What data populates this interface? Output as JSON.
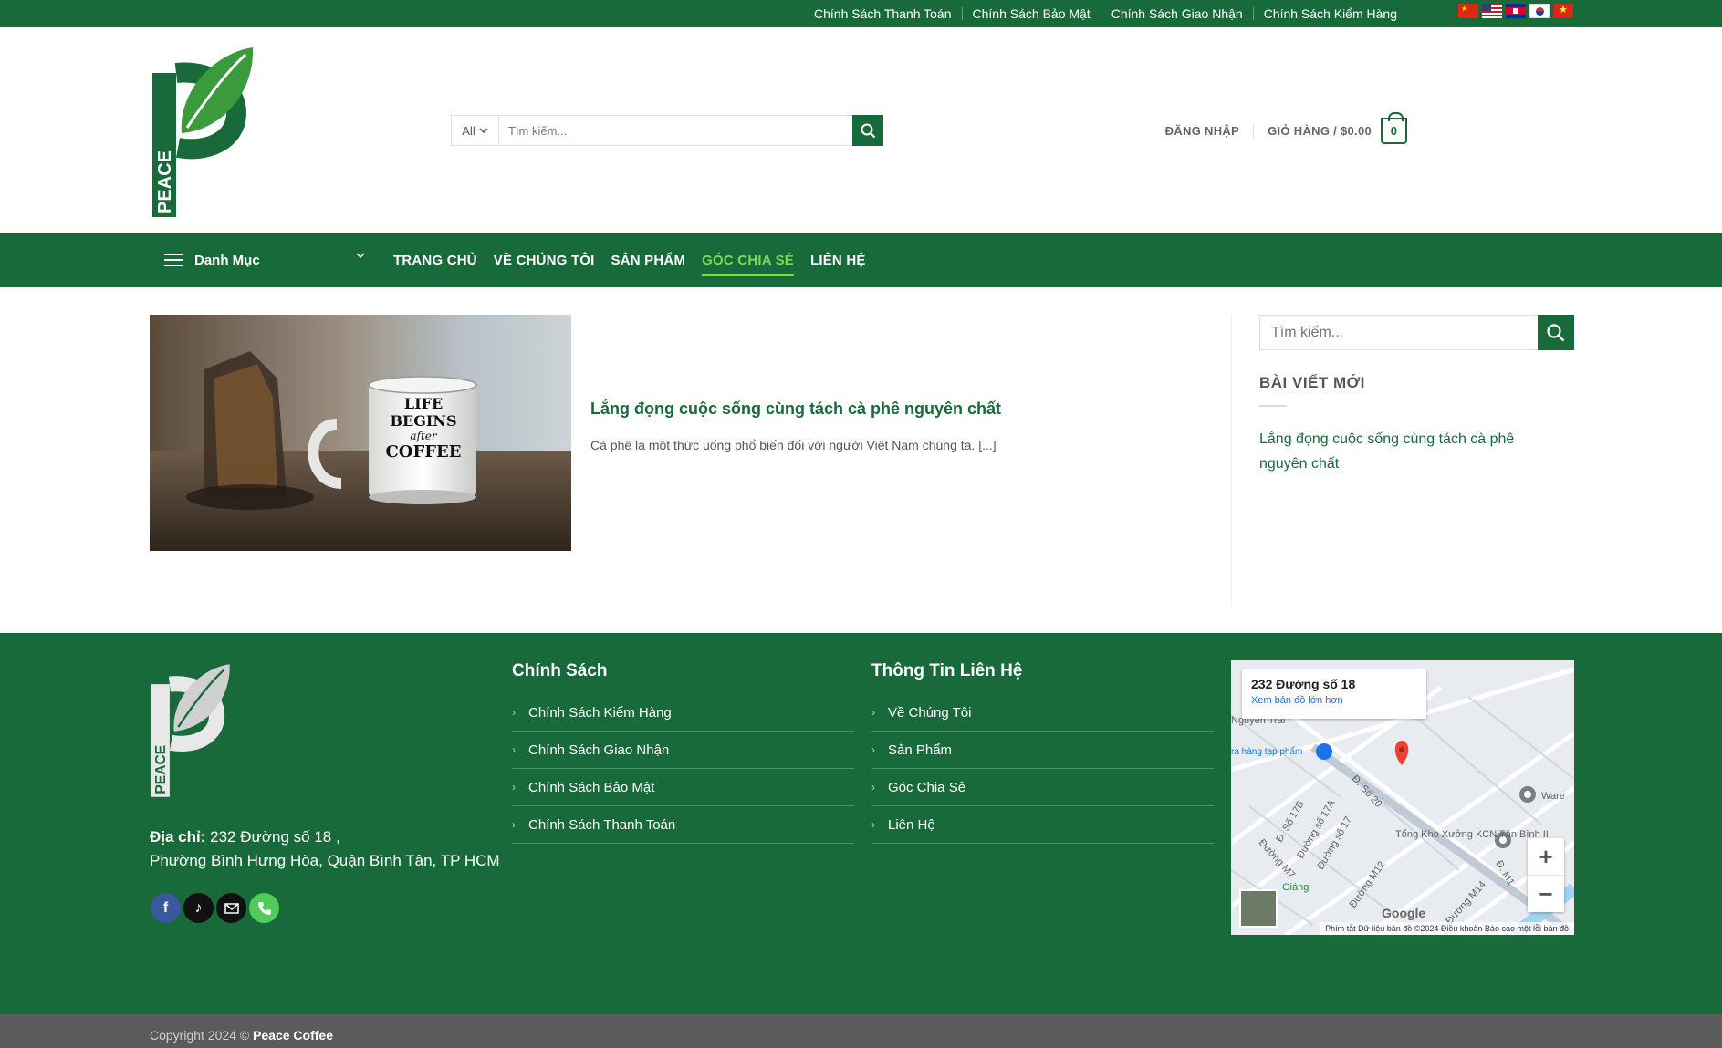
{
  "topbar": {
    "links": [
      "Chính Sách Thanh Toán",
      "Chính Sách Bảo Mật",
      "Chính Sách Giao Nhận",
      "Chính Sách Kiểm Hàng"
    ],
    "flags": [
      "china-flag-icon",
      "usa-flag-icon",
      "cambodia-flag-icon",
      "korea-flag-icon",
      "vietnam-flag-icon"
    ]
  },
  "header": {
    "logo_text": "PEACE",
    "search_category": "All",
    "search_placeholder": "Tìm kiếm...",
    "login": "ĐĂNG NHẬP",
    "cart_label": "GIỎ HÀNG / $0.00",
    "cart_count": "0"
  },
  "nav": {
    "menu_label": "Danh Mục",
    "items": [
      "TRANG CHỦ",
      "VỀ CHÚNG TÔI",
      "SẢN PHẨM",
      "GÓC CHIA SẺ",
      "LIÊN HỆ"
    ],
    "active_index": 3
  },
  "post": {
    "mug_text": [
      "LIFE",
      "BEGINS",
      "after",
      "COFFEE"
    ],
    "title": "Lắng đọng cuộc sống cùng tách cà phê nguyên chất",
    "excerpt": "Cà phê là một thức uống phổ biến đối với người Việt Nam chúng ta. [...]"
  },
  "sidebar": {
    "search_placeholder": "Tìm kiếm...",
    "heading": "BÀI VIẾT MỚI",
    "recent_post": "Lắng đọng cuộc sống cùng tách cà phê nguyên chất"
  },
  "footer": {
    "logo_text": "PEACE",
    "address_label": "Địa chỉ:",
    "address_line1": "232 Đường số 18 ,",
    "address_line2": "Phường Bình Hưng Hòa, Quận Bình Tân, TP HCM",
    "col1": {
      "heading": "Chính Sách",
      "items": [
        "Chính Sách Kiểm Hàng",
        "Chính Sách Giao Nhận",
        "Chính Sách Bảo Mật",
        "Chính Sách Thanh Toán"
      ]
    },
    "col2": {
      "heading": "Thông Tin Liên Hệ",
      "items": [
        "Về Chúng Tôi",
        "Sản Phẩm",
        "Góc Chia Sẻ",
        "Liên Hệ"
      ]
    },
    "map": {
      "place": "232 Đường số 18",
      "link": "Xem bản đồ lớn hơn",
      "labels": [
        "Đường M7",
        "Đường M12",
        "Đường M14",
        "Đ. Số 20",
        "Đ. Số 17B",
        "Đường số 17A",
        "Đường số 17",
        "Tổng Kho Xưởng KCN Tân Bình II",
        "Ware",
        "Giáng",
        "Đ. M1",
        "ra hàng tạp phẩm",
        "Nguyễn Trãi"
      ],
      "logo": "Google",
      "attrib": "Phím tắt   Dữ liệu bản đồ ©2024   Điều khoản   Báo cáo một lỗi bản đồ"
    },
    "copyright_prefix": "Copyright 2024 © ",
    "copyright_brand": "Peace Coffee"
  },
  "colors": {
    "brand": "#186a3b",
    "accent": "#7ed957",
    "footer_bottom": "#5b5b5b"
  }
}
